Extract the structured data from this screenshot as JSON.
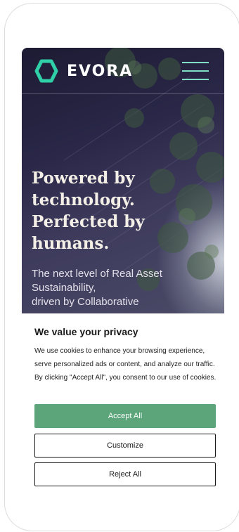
{
  "brand": {
    "name": "EVORA",
    "accent": "#2fd0a8"
  },
  "header": {
    "menu_icon": "hamburger-icon"
  },
  "hero": {
    "headline": "Powered by\ntechnology.\nPerfected by\nhumans.",
    "subtext": "The next level of Real Asset\nSustainability,\ndriven by Collaborative"
  },
  "cookie_banner": {
    "title": "We value your privacy",
    "text": "We use cookies to enhance your browsing experience, serve personalized ads or content, and analyze our traffic. By clicking \"Accept All\", you consent to our use of cookies.",
    "accept_label": "Accept All",
    "customize_label": "Customize",
    "reject_label": "Reject All",
    "accept_color": "#5ca57a"
  }
}
